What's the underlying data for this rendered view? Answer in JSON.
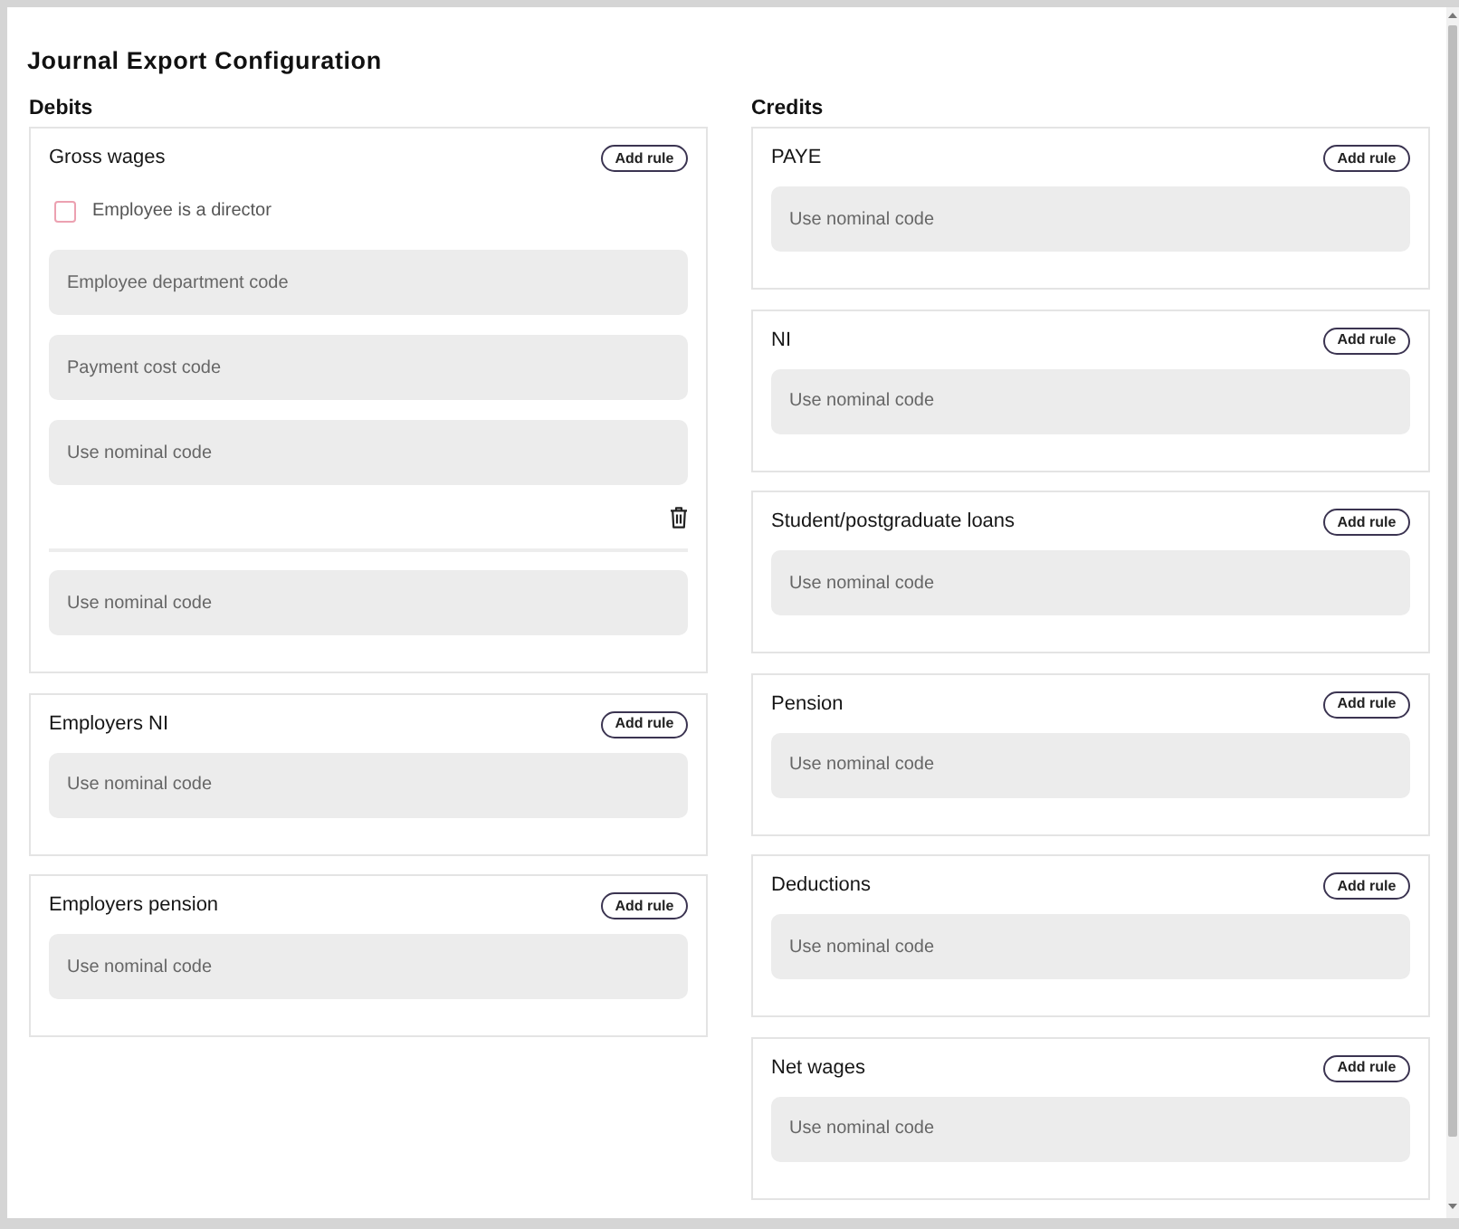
{
  "page": {
    "title": "Journal Export Configuration"
  },
  "sections": [
    {
      "heading": "Debits",
      "cards": [
        {
          "title": "Gross wages",
          "button": "Add rule",
          "rules": [
            {
              "checkbox": {
                "label": "Employee is a director",
                "checked": false
              },
              "fields": [
                {
                  "placeholder": "Employee department code"
                },
                {
                  "placeholder": "Payment cost code"
                },
                {
                  "placeholder": "Use nominal code"
                }
              ],
              "removable": true
            },
            {
              "fields": [
                {
                  "placeholder": "Use nominal code"
                }
              ]
            }
          ]
        },
        {
          "title": "Employers NI",
          "button": "Add rule",
          "rules": [
            {
              "fields": [
                {
                  "placeholder": "Use nominal code"
                }
              ]
            }
          ]
        },
        {
          "title": "Employers pension",
          "button": "Add rule",
          "rules": [
            {
              "fields": [
                {
                  "placeholder": "Use nominal code"
                }
              ]
            }
          ]
        }
      ]
    },
    {
      "heading": "Credits",
      "cards": [
        {
          "title": "PAYE",
          "button": "Add rule",
          "rules": [
            {
              "fields": [
                {
                  "placeholder": "Use nominal code"
                }
              ]
            }
          ]
        },
        {
          "title": "NI",
          "button": "Add rule",
          "rules": [
            {
              "fields": [
                {
                  "placeholder": "Use nominal code"
                }
              ]
            }
          ]
        },
        {
          "title": "Student/postgraduate loans",
          "button": "Add rule",
          "rules": [
            {
              "fields": [
                {
                  "placeholder": "Use nominal code"
                }
              ]
            }
          ]
        },
        {
          "title": "Pension",
          "button": "Add rule",
          "rules": [
            {
              "fields": [
                {
                  "placeholder": "Use nominal code"
                }
              ]
            }
          ]
        },
        {
          "title": "Deductions",
          "button": "Add rule",
          "rules": [
            {
              "fields": [
                {
                  "placeholder": "Use nominal code"
                }
              ]
            }
          ]
        },
        {
          "title": "Net wages",
          "button": "Add rule",
          "rules": [
            {
              "fields": [
                {
                  "placeholder": "Use nominal code"
                }
              ]
            }
          ]
        }
      ]
    }
  ]
}
